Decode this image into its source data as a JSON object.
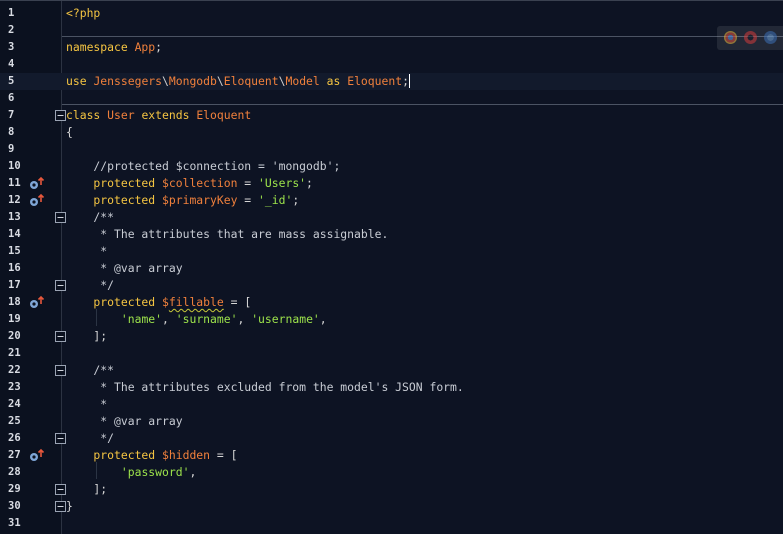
{
  "editor": {
    "language": "php",
    "current_line": 5,
    "colors": {
      "background": "#0d1323",
      "keyword": "#f5c542",
      "identifier": "#f0803c",
      "string": "#9de34b",
      "comment": "#c8ccd4",
      "line_number": "#d9dce3"
    },
    "override_marker_lines": [
      11,
      12,
      18,
      27
    ],
    "fold_marker_lines": [
      7,
      13,
      17,
      20,
      22,
      26,
      29,
      30
    ],
    "lines": [
      {
        "n": "1",
        "tokens": [
          {
            "t": "<?php",
            "c": "tag"
          }
        ]
      },
      {
        "n": "2",
        "tokens": []
      },
      {
        "n": "3",
        "tokens": [
          {
            "t": "namespace ",
            "c": "kw"
          },
          {
            "t": "App",
            "c": "cls"
          },
          {
            "t": ";",
            "c": "pl"
          }
        ]
      },
      {
        "n": "4",
        "tokens": []
      },
      {
        "n": "5",
        "tokens": [
          {
            "t": "use ",
            "c": "kw"
          },
          {
            "t": "Jenssegers",
            "c": "cls"
          },
          {
            "t": "\\",
            "c": "sep"
          },
          {
            "t": "Mongodb",
            "c": "cls"
          },
          {
            "t": "\\",
            "c": "sep"
          },
          {
            "t": "Eloquent",
            "c": "cls"
          },
          {
            "t": "\\",
            "c": "sep"
          },
          {
            "t": "Model",
            "c": "cls"
          },
          {
            "t": " as ",
            "c": "kw"
          },
          {
            "t": "Eloquent",
            "c": "cls"
          },
          {
            "t": ";",
            "c": "pl"
          }
        ]
      },
      {
        "n": "6",
        "tokens": []
      },
      {
        "n": "7",
        "tokens": [
          {
            "t": "class ",
            "c": "kw"
          },
          {
            "t": "User",
            "c": "cls"
          },
          {
            "t": " extends ",
            "c": "kw"
          },
          {
            "t": "Eloquent",
            "c": "cls"
          }
        ]
      },
      {
        "n": "8",
        "tokens": [
          {
            "t": "{",
            "c": "pl"
          }
        ]
      },
      {
        "n": "9",
        "tokens": []
      },
      {
        "n": "10",
        "tokens": [
          {
            "t": "    //protected $connection = 'mongodb';",
            "c": "cm"
          }
        ]
      },
      {
        "n": "11",
        "tokens": [
          {
            "t": "    protected ",
            "c": "kw"
          },
          {
            "t": "$collection",
            "c": "var"
          },
          {
            "t": " = ",
            "c": "pl"
          },
          {
            "t": "'Users'",
            "c": "str"
          },
          {
            "t": ";",
            "c": "pl"
          }
        ]
      },
      {
        "n": "12",
        "tokens": [
          {
            "t": "    protected ",
            "c": "kw"
          },
          {
            "t": "$primaryKey",
            "c": "var"
          },
          {
            "t": " = ",
            "c": "pl"
          },
          {
            "t": "'_id'",
            "c": "str"
          },
          {
            "t": ";",
            "c": "pl"
          }
        ]
      },
      {
        "n": "13",
        "tokens": [
          {
            "t": "    /**",
            "c": "cm"
          }
        ]
      },
      {
        "n": "14",
        "tokens": [
          {
            "t": "     * The attributes that are mass assignable.",
            "c": "cm"
          }
        ]
      },
      {
        "n": "15",
        "tokens": [
          {
            "t": "     *",
            "c": "cm"
          }
        ]
      },
      {
        "n": "16",
        "tokens": [
          {
            "t": "     * @var array",
            "c": "cm"
          }
        ]
      },
      {
        "n": "17",
        "tokens": [
          {
            "t": "     */",
            "c": "cm"
          }
        ]
      },
      {
        "n": "18",
        "tokens": [
          {
            "t": "    protected ",
            "c": "kw"
          },
          {
            "t": "$",
            "c": "var"
          },
          {
            "t": "fillable",
            "c": "var squig"
          },
          {
            "t": " = [",
            "c": "pl"
          }
        ]
      },
      {
        "n": "19",
        "tokens": [
          {
            "t": "        ",
            "c": "pl"
          },
          {
            "t": "'name'",
            "c": "str"
          },
          {
            "t": ", ",
            "c": "pl"
          },
          {
            "t": "'surname'",
            "c": "str"
          },
          {
            "t": ", ",
            "c": "pl"
          },
          {
            "t": "'username'",
            "c": "str"
          },
          {
            "t": ",",
            "c": "pl"
          }
        ]
      },
      {
        "n": "20",
        "tokens": [
          {
            "t": "    ];",
            "c": "pl"
          }
        ]
      },
      {
        "n": "21",
        "tokens": []
      },
      {
        "n": "22",
        "tokens": [
          {
            "t": "    /**",
            "c": "cm"
          }
        ]
      },
      {
        "n": "23",
        "tokens": [
          {
            "t": "     * The attributes excluded from the model's JSON form.",
            "c": "cm"
          }
        ]
      },
      {
        "n": "24",
        "tokens": [
          {
            "t": "     *",
            "c": "cm"
          }
        ]
      },
      {
        "n": "25",
        "tokens": [
          {
            "t": "     * @var array",
            "c": "cm"
          }
        ]
      },
      {
        "n": "26",
        "tokens": [
          {
            "t": "     */",
            "c": "cm"
          }
        ]
      },
      {
        "n": "27",
        "tokens": [
          {
            "t": "    protected ",
            "c": "kw"
          },
          {
            "t": "$hidden",
            "c": "var"
          },
          {
            "t": " = [",
            "c": "pl"
          }
        ]
      },
      {
        "n": "28",
        "tokens": [
          {
            "t": "        ",
            "c": "pl"
          },
          {
            "t": "'password'",
            "c": "str"
          },
          {
            "t": ",",
            "c": "pl"
          }
        ]
      },
      {
        "n": "29",
        "tokens": [
          {
            "t": "    ];",
            "c": "pl"
          }
        ]
      },
      {
        "n": "30",
        "tokens": [
          {
            "t": "}",
            "c": "pl"
          }
        ]
      },
      {
        "n": "31",
        "tokens": []
      }
    ]
  },
  "overlay": {
    "icons": [
      "chrome-icon",
      "opera-icon",
      "browser-icon"
    ]
  }
}
